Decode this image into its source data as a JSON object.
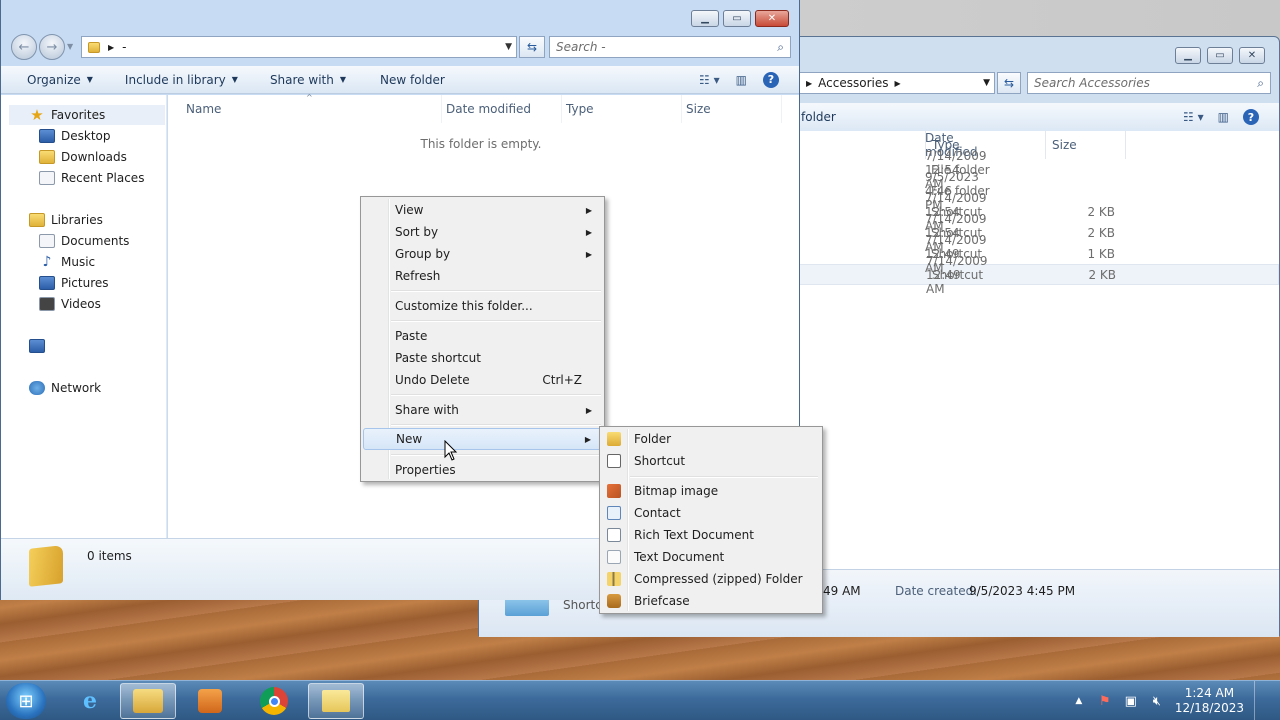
{
  "back_window": {
    "address_crumb": "Accessories",
    "search_placeholder": "Search Accessories",
    "cmd_new_folder_partial": "folder",
    "columns": [
      "Date modified",
      "Type",
      "Size"
    ],
    "rows": [
      {
        "date": "7/14/2009 12:54 AM",
        "type": "File folder",
        "size": ""
      },
      {
        "date": "9/5/2023 4:46 PM",
        "type": "File folder",
        "size": ""
      },
      {
        "date": "7/14/2009 12:54 AM",
        "type": "Shortcut",
        "size": "2 KB"
      },
      {
        "date": "7/14/2009 12:54 AM",
        "type": "Shortcut",
        "size": "2 KB"
      },
      {
        "date": "7/14/2009 12:49 AM",
        "type": "Shortcut",
        "size": "1 KB"
      },
      {
        "date": "7/14/2009 12:49 AM",
        "type": "Shortcut",
        "size": "2 KB"
      }
    ],
    "status_item_label": "Shortc",
    "status_modified": "49 AM",
    "status_created_label": "Date created:",
    "status_created_value": "9/5/2023 4:45 PM"
  },
  "front_window": {
    "address_text": "-",
    "search_placeholder": "Search -",
    "toolbar": {
      "organize": "Organize",
      "include_in_library": "Include in library",
      "share_with": "Share with",
      "new_folder": "New folder"
    },
    "nav": {
      "favorites": "Favorites",
      "desktop": "Desktop",
      "downloads": "Downloads",
      "recent_places": "Recent Places",
      "libraries": "Libraries",
      "documents": "Documents",
      "music": "Music",
      "pictures": "Pictures",
      "videos": "Videos",
      "network": "Network"
    },
    "columns": {
      "name": "Name",
      "date_modified": "Date modified",
      "type": "Type",
      "size": "Size"
    },
    "empty_message": "This folder is empty.",
    "status_items": "0 items"
  },
  "context_menu": {
    "view": "View",
    "sort_by": "Sort by",
    "group_by": "Group by",
    "refresh": "Refresh",
    "customize": "Customize this folder...",
    "paste": "Paste",
    "paste_shortcut": "Paste shortcut",
    "undo_delete": "Undo Delete",
    "undo_shortcut": "Ctrl+Z",
    "share_with": "Share with",
    "new": "New",
    "properties": "Properties"
  },
  "new_submenu": {
    "folder": "Folder",
    "shortcut": "Shortcut",
    "bitmap": "Bitmap image",
    "contact": "Contact",
    "rtf": "Rich Text Document",
    "text": "Text Document",
    "zip": "Compressed (zipped) Folder",
    "briefcase": "Briefcase"
  },
  "taskbar": {
    "time": "1:24 AM",
    "date": "12/18/2023"
  }
}
